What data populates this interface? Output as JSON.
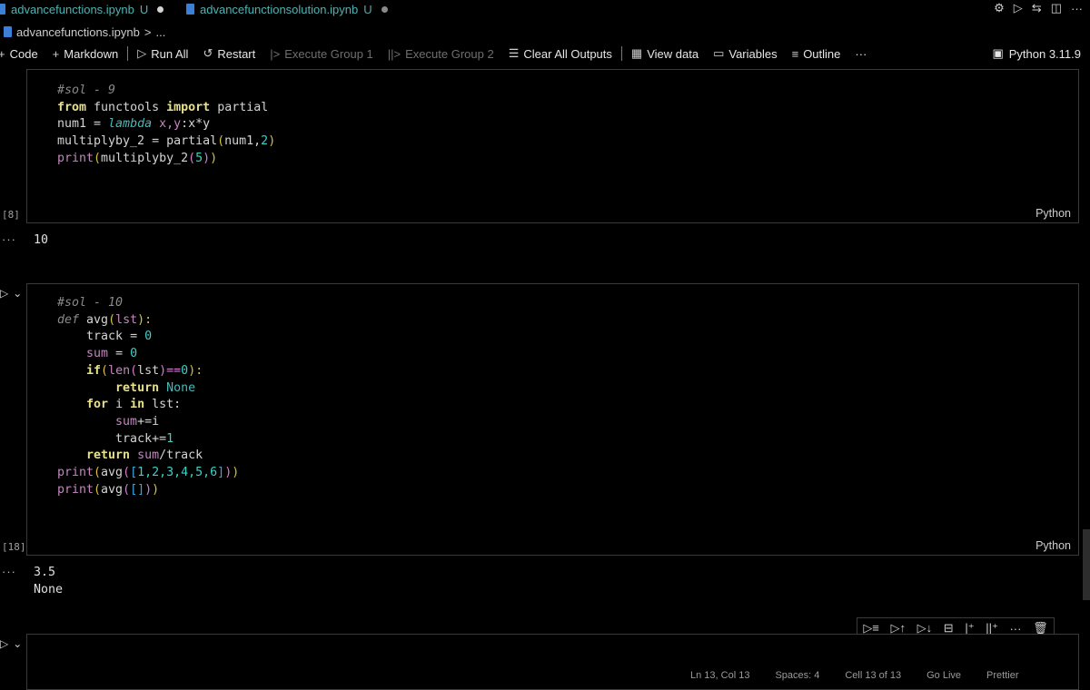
{
  "tabs": [
    {
      "label": "advancefunctions.ipynb",
      "status": "U",
      "active": true
    },
    {
      "label": "advancefunctionsolution.ipynb",
      "status": "U",
      "active": false
    }
  ],
  "top_right_icons": [
    "gear-icon",
    "run-icon",
    "compare-icon",
    "split-icon",
    "more-icon"
  ],
  "breadcrumb": {
    "file": "advancefunctions.ipynb",
    "chevron": ">",
    "rest": "..."
  },
  "toolbar": {
    "code": "Code",
    "markdown": "Markdown",
    "run_all": "Run All",
    "restart": "Restart",
    "execute_group_1": "Execute Group 1",
    "execute_group_2": "Execute Group 2",
    "clear_all_outputs": "Clear All Outputs",
    "view_data": "View data",
    "variables": "Variables",
    "outline": "Outline",
    "more": "···",
    "kernel": "Python 3.11.9"
  },
  "cells": [
    {
      "exec_count": "[8]",
      "language": "Python",
      "output": [
        "10"
      ]
    },
    {
      "exec_count": "[18]",
      "language": "Python",
      "output": [
        "3.5",
        "None"
      ]
    }
  ],
  "code": {
    "cell1": {
      "l1": "#sol - 9",
      "l2_kw": "from",
      "l2_mod": "functools",
      "l2_kw2": "import",
      "l2_name": "partial",
      "l3_a": "num1 = ",
      "l3_lambda": "lambda",
      "l3_args": "x,y",
      "l3_colon": ":x*y",
      "l4_a": "multiplyby_2 = partial",
      "l4_b": "(",
      "l4_c": "num1,",
      "l4_d": "2",
      "l4_e": ")",
      "l5_a": "print",
      "l5_b": "(",
      "l5_c": "multiplyby_2",
      "l5_d": "(",
      "l5_e": "5",
      "l5_f": ")",
      "l5_g": ")"
    },
    "cell2": {
      "l1": "#sol - 10",
      "l2_def": "def",
      "l2_name": " avg",
      "l2_p": "(",
      "l2_arg": "lst",
      "l2_q": "):",
      "l3": "track = ",
      "l3_n": "0",
      "l4": "sum",
      "l4_b": " = ",
      "l4_n": "0",
      "l5_kw": "if",
      "l5_a": "(",
      "l5_fn": "len",
      "l5_b": "(",
      "l5_c": "lst",
      "l5_d": ")==",
      "l5_n": "0",
      "l5_e": "):",
      "l6_kw": "return",
      "l6_v": " None",
      "l7_kw": "for",
      "l7_a": " i ",
      "l7_kw2": "in",
      "l7_b": " lst:",
      "l8_a": "sum",
      "l8_b": "+=i",
      "l9_a": "track",
      "l9_b": "+=",
      "l9_n": "1",
      "l10_kw": "return",
      "l10_a": " sum",
      "l10_b": "/track",
      "l11_a": "print",
      "l11_b": "(",
      "l11_c": "avg",
      "l11_d": "(",
      "l11_e": "[",
      "l11_f": "1,2,3,4,5,6",
      "l11_g": "]",
      "l11_h": ")",
      "l11_i": ")",
      "l12_a": "print",
      "l12_b": "(",
      "l12_c": "avg",
      "l12_d": "(",
      "l12_e": "[]",
      "l12_f": ")",
      "l12_g": ")"
    }
  },
  "status_bar": [
    "Ln 13, Col 13",
    "Spaces: 4",
    "Cell 13 of 13",
    "Go Live",
    "Prettier"
  ],
  "colors": {
    "background": "#000000",
    "accent_tab": "#4fb3b3",
    "border": "#3a3a3a"
  }
}
